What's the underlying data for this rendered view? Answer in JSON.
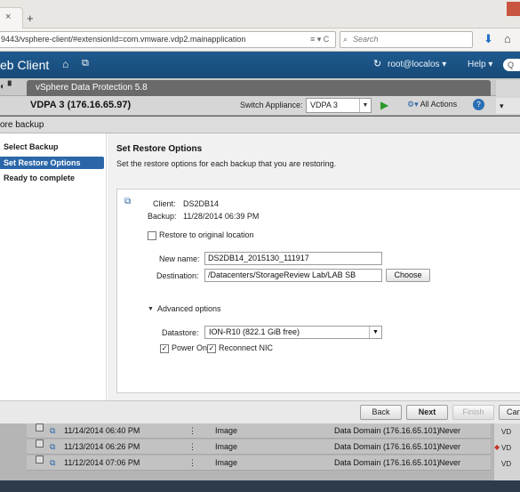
{
  "browser": {
    "tab_close": "×",
    "new_tab": "+",
    "url": "9443/vsphere-client/#extensionId=com.vmware.vdp2.mainapplication",
    "url_controls": "≡ ▾ C",
    "search_placeholder": "Search"
  },
  "header": {
    "title": "eb Client",
    "user": "root@localos ▾",
    "help": "Help ▾"
  },
  "app": {
    "tab_title": "vSphere Data Protection 5.8",
    "appliance_label": "VDPA 3 (176.16.65.97)",
    "switch_label": "Switch Appliance:",
    "switch_value": "VDPA 3",
    "all_actions": "All Actions",
    "right_panel_text": "▾"
  },
  "dialog": {
    "title": "ore backup",
    "steps": [
      "Select Backup",
      "Set Restore Options",
      "Ready to complete"
    ],
    "active_step": 1,
    "heading": "Set Restore Options",
    "description": "Set the restore options for each backup that you are restoring.",
    "client_label": "Client:",
    "client_value": "DS2DB14",
    "backup_label": "Backup:",
    "backup_value": "11/28/2014 06:39 PM",
    "restore_original_label": "Restore to original location",
    "restore_original_checked": false,
    "new_name_label": "New name:",
    "new_name_value": "DS2DB14_2015130_111917",
    "destination_label": "Destination:",
    "destination_value": "/Datacenters/StorageReview Lab/LAB SB",
    "choose_label": "Choose",
    "advanced_label": "Advanced options",
    "datastore_label": "Datastore:",
    "datastore_value": "ION-R10 (822.1 GiB free)",
    "power_on_label": "Power On",
    "power_on_checked": true,
    "reconnect_nic_label": "Reconnect NIC",
    "reconnect_nic_checked": true
  },
  "footer": {
    "back": "Back",
    "next": "Next",
    "finish": "Finish",
    "cancel": "Can"
  },
  "background_table": {
    "rows": [
      {
        "date": "11/14/2014 06:40 PM",
        "type": "Image",
        "target": "Data Domain (176.16.65.101)",
        "expires": "Never"
      },
      {
        "date": "11/13/2014 06:26 PM",
        "type": "Image",
        "target": "Data Domain (176.16.65.101)",
        "expires": "Never"
      },
      {
        "date": "11/12/2014 07:06 PM",
        "type": "Image",
        "target": "Data Domain (176.16.65.101)",
        "expires": "Never"
      }
    ],
    "side_labels": [
      "VD",
      "VD",
      "VD"
    ]
  }
}
